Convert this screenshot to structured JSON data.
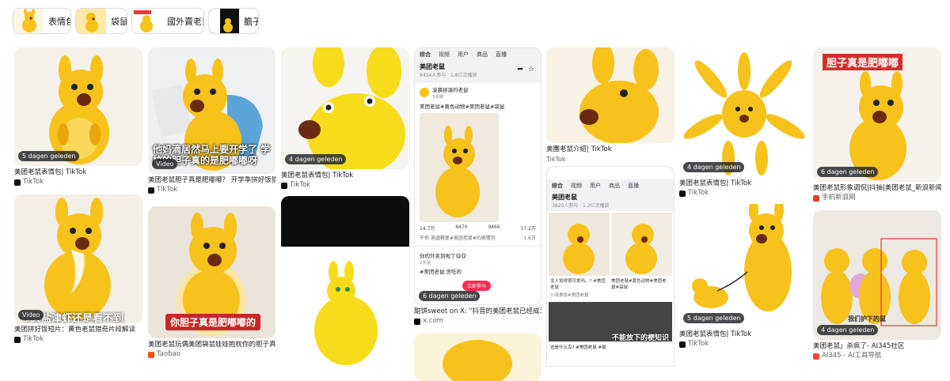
{
  "chips": [
    {
      "label": "表情包",
      "icon": "kangaroo-thumb-icon"
    },
    {
      "label": "袋鼠",
      "icon": "kangaroo-thumb-icon"
    },
    {
      "label": "國外賣老鼠",
      "icon": "kangaroo-thumb-icon"
    },
    {
      "label": "膽子",
      "icon": "kangaroo-thumb-icon"
    }
  ],
  "results": [
    {
      "id": "r1",
      "badge": "5 dagen geleden",
      "caption": "美团老鼠表情包| TikTok",
      "source": "TikTok"
    },
    {
      "id": "r2",
      "badge": "Video",
      "overlay": "他妈滴居然马上要开学了 学校的胆子真的是肥嘟嘟呀",
      "caption": "美团老鼠胆子真是肥嘟嘟？ 开学季拼好饭猎奇...",
      "source": "TikTok"
    },
    {
      "id": "r3",
      "badge": "4 dagen geleden",
      "caption": "美团老鼠表情包| TikTok",
      "source": "TikTok"
    },
    {
      "id": "r4",
      "phone_tabs": [
        "综合",
        "视频",
        "用户",
        "商品",
        "直播"
      ],
      "phone_title": "美团老鼠",
      "phone_sub": "8434人参与 · 1.8亿次播放",
      "post_user": "凌晨拼凑的老鼠",
      "post_time": "3天前",
      "post_tags": "美团老鼠#黄色动物#美团老鼠#袋鼠",
      "stats": [
        "14.7万",
        "8470",
        "9866",
        "17.2万"
      ],
      "comment": "干你 迪迦赛复#美团老鼠#的表情包",
      "comment_count": "1.6万",
      "sub2": "你的外卖到啦了😋😋",
      "sub2_time": "2天前",
      "sub2_tags": "#美团老鼠 贪吃的",
      "join": "立即参与",
      "badge": "6 dagen geleden",
      "caption": "甜饼sweet on X: \"抖音的美团老鼠已经成为...",
      "source": "x.com"
    },
    {
      "id": "r5",
      "caption": "美團老鼠介紹| TikTok",
      "source": "TikTok",
      "phone_tabs": [
        "综合",
        "视频",
        "用户",
        "商品",
        "直播"
      ],
      "phone_title": "美团老鼠",
      "phone_sub": "3820人参与 · 1.2亿次播放",
      "mini1": "没人觉得很可爱吗。? #美团老鼠",
      "mini2": "小鸡食饭#美团老鼠",
      "mini2_count": "6766",
      "mini3": "美团老鼠#黄色动物#美团老鼠#袋鼠",
      "bottom_overlay": "不能放下的梗知识",
      "bottom_cap": "这是什么鸟? #美团老鼠 #鼠",
      "mini_count": "1.6万",
      "top_bar": "TikTok"
    },
    {
      "id": "r6",
      "badge": "4 dagen geleden",
      "caption": "美团老鼠表情包| TikTok",
      "source": "TikTok"
    },
    {
      "id": "r7",
      "badge": "6 dagen geleden",
      "overlay": "胆子真是肥嘟嘟",
      "caption": "美团老鼠形象调侃|抖抽|美团老鼠_新浪新闻",
      "source": "手机新浪网"
    },
    {
      "id": "r8",
      "badge": "Video",
      "overlay": "今天盐津虾还是看不到",
      "caption": "美团拼好饭短片：黄色老鼠猎奇片段解读",
      "source": "TikTok"
    },
    {
      "id": "r9",
      "overlay": "你胆子真是肥嘟嘟的",
      "caption": "美团老鼠玩偶美团袋鼠娃娃抱枕你的胆子真是...",
      "source": "Taobao"
    },
    {
      "id": "r10",
      "badge": "5 dagen geleden",
      "caption": "美团老鼠表情包| TikTok",
      "source": "TikTok"
    },
    {
      "id": "r11",
      "badge": "4 dagen geleden",
      "overlay": "我们护下的鼠",
      "caption": "美团老鼠」杀疯了- AI345社区",
      "source": "AI345 - AI工具导航"
    }
  ],
  "colors": {
    "kangaroo": "#f6c21b",
    "kangaroo_shade": "#e9a70c",
    "nose": "#6b2a12",
    "bg_soft": "#f2efe9",
    "pack": "#5aa4d8",
    "red": "#e53935"
  }
}
